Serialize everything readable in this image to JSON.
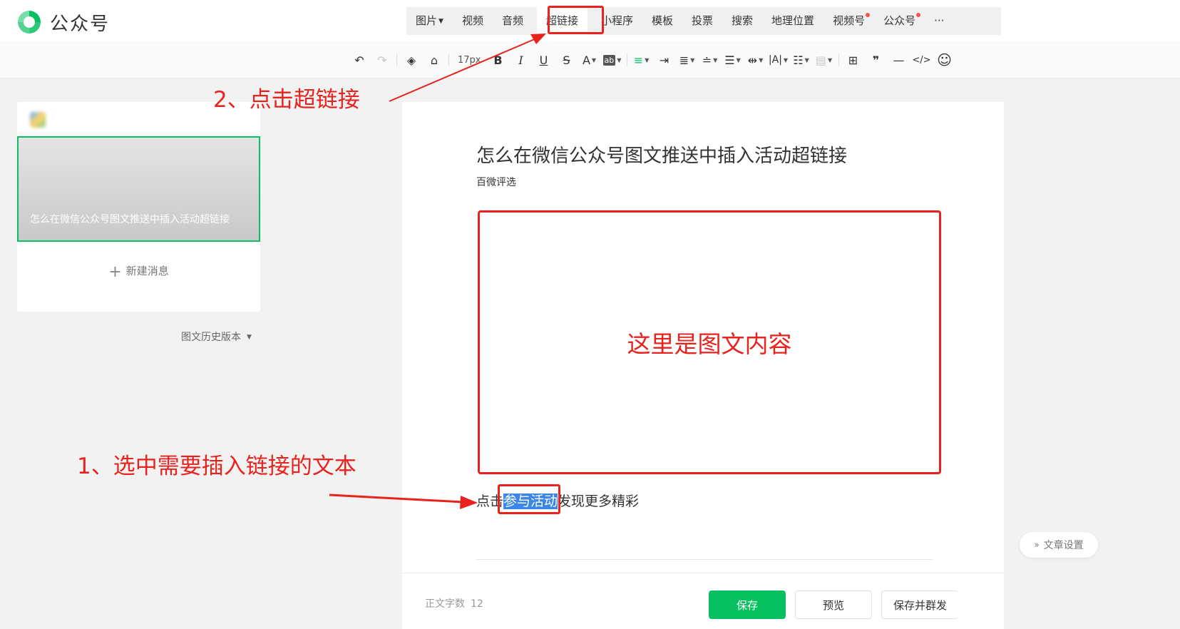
{
  "app": {
    "title": "公众号"
  },
  "insert_menu": {
    "items": [
      {
        "label": "图片",
        "has_caret": true,
        "has_dot": false
      },
      {
        "label": "视频",
        "has_caret": false,
        "has_dot": false
      },
      {
        "label": "音频",
        "has_caret": false,
        "has_dot": false
      },
      {
        "label": "超链接",
        "has_caret": false,
        "has_dot": false,
        "active": true
      },
      {
        "label": "小程序",
        "has_caret": false,
        "has_dot": false
      },
      {
        "label": "模板",
        "has_caret": false,
        "has_dot": false
      },
      {
        "label": "投票",
        "has_caret": false,
        "has_dot": false
      },
      {
        "label": "搜索",
        "has_caret": false,
        "has_dot": false
      },
      {
        "label": "地理位置",
        "has_caret": false,
        "has_dot": false
      },
      {
        "label": "视频号",
        "has_caret": false,
        "has_dot": true
      },
      {
        "label": "公众号",
        "has_caret": false,
        "has_dot": true
      },
      {
        "label": "···",
        "has_caret": false,
        "has_dot": false
      }
    ]
  },
  "format_toolbar": {
    "font_size": "17px"
  },
  "left_panel": {
    "article_card_title": "怎么在微信公众号图文推送中插入活动超链接",
    "new_message_label": "新建消息",
    "history_label": "图文历史版本"
  },
  "editor": {
    "title": "怎么在微信公众号图文推送中插入活动超链接",
    "author": "百微评选",
    "content_placeholder": "这里是图文内容",
    "body_before": "点击",
    "body_selected": "参与活动",
    "body_after": "发现更多精彩"
  },
  "footer": {
    "word_count_label": "正文字数",
    "word_count_value": "12",
    "save_label": "保存",
    "preview_label": "预览",
    "publish_label": "保存并群发"
  },
  "settings_label": "文章设置",
  "annotations": {
    "step1": "1、选中需要插入链接的文本",
    "step2": "2、点击超链接"
  },
  "colors": {
    "brand_green": "#07c160",
    "annotation_red": "#e8231e",
    "selection_blue": "#3b86e8"
  }
}
